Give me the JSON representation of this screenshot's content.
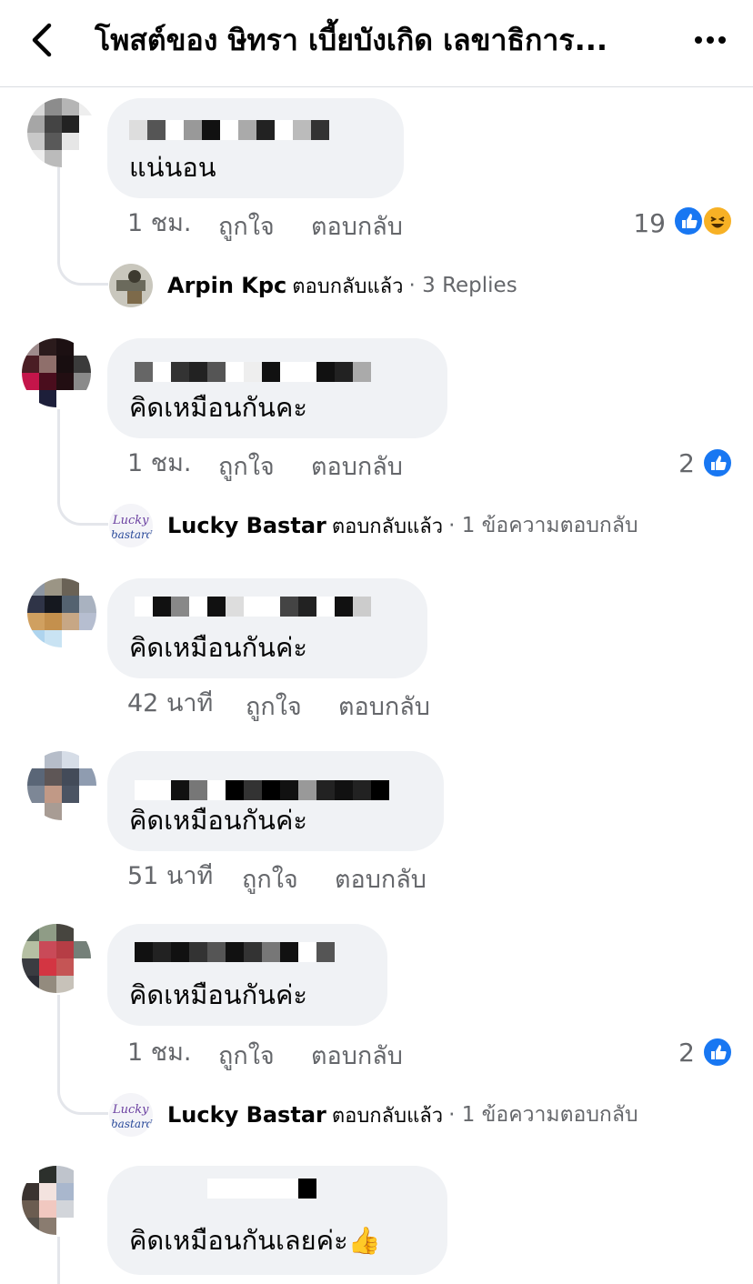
{
  "header": {
    "title": "โพสต์ของ ษิทรา เบี้ยบังเกิด เลขาธิการ...",
    "back_icon": "chevron-left-icon",
    "more_icon": "more-dots-icon"
  },
  "actions": {
    "like": "ถูกใจ",
    "reply": "ตอบกลับ"
  },
  "comments": [
    {
      "text": "แน่นอน",
      "time": "1 ชม.",
      "reaction_count": "19",
      "reactions": [
        "like-reaction-icon",
        "haha-reaction-icon"
      ],
      "reply_preview": {
        "name": "Arpin Kpc",
        "verb": "ตอบกลับแล้ว",
        "count": "· 3 Replies"
      }
    },
    {
      "text": "คิดเหมือนกันคะ",
      "time": "1 ชม.",
      "reaction_count": "2",
      "reactions": [
        "like-reaction-icon"
      ],
      "reply_preview": {
        "name": "Lucky Bastar",
        "verb": "ตอบกลับแล้ว",
        "count": "· 1 ข้อความตอบกลับ"
      }
    },
    {
      "text": "คิดเหมือนกันค่ะ",
      "time": "42 นาที"
    },
    {
      "text": "คิดเหมือนกันค่ะ",
      "time": "51 นาที"
    },
    {
      "text": "คิดเหมือนกันค่ะ",
      "time": "1 ชม.",
      "reaction_count": "2",
      "reactions": [
        "like-reaction-icon"
      ],
      "reply_preview": {
        "name": "Lucky Bastar",
        "verb": "ตอบกลับแล้ว",
        "count": "· 1 ข้อความตอบกลับ"
      }
    },
    {
      "text": "คิดเหมือนกันเลยค่ะ👍"
    }
  ],
  "colors": {
    "bubble": "#f0f2f5",
    "meta_text": "#65676b",
    "like_blue": "#1877f2",
    "haha_yellow": "#f7b125"
  }
}
